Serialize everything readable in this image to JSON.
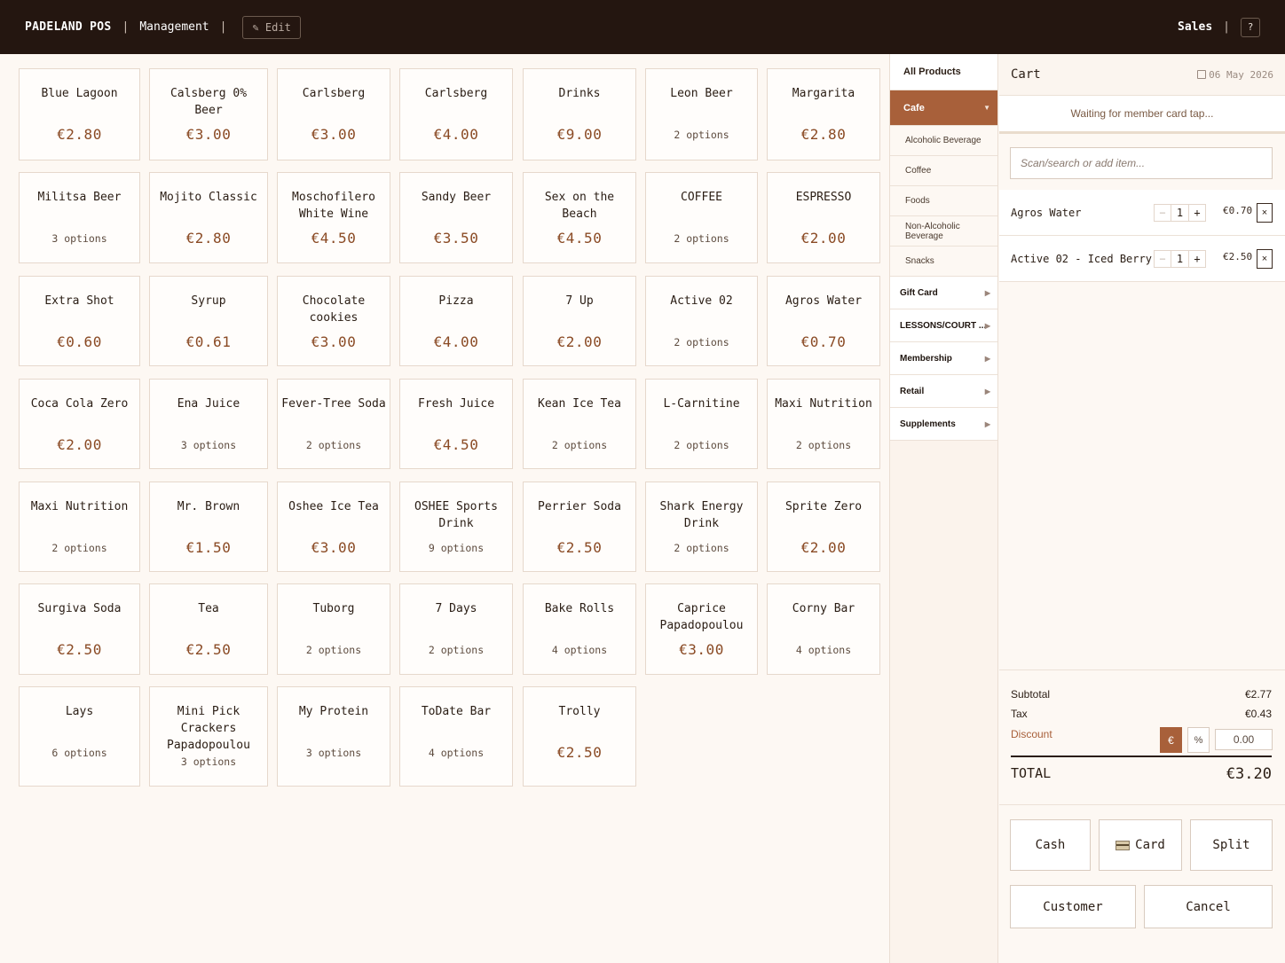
{
  "header": {
    "brand": "PADELAND POS",
    "separator": "|",
    "section": "Management",
    "edit_icon": "pencil-icon",
    "edit_label": "✎ Edit",
    "sales_label": "Sales",
    "help_label": "?"
  },
  "products": [
    {
      "name": "Blue Lagoon",
      "price": "€2.80"
    },
    {
      "name": "Calsberg 0% Beer",
      "price": "€3.00"
    },
    {
      "name": "Carlsberg",
      "price": "€3.00"
    },
    {
      "name": "Carlsberg",
      "price": "€4.00"
    },
    {
      "name": "Drinks",
      "price": "€9.00"
    },
    {
      "name": "Leon Beer",
      "options": "2 options"
    },
    {
      "name": "Margarita",
      "price": "€2.80"
    },
    {
      "name": "Militsa Beer",
      "options": "3 options"
    },
    {
      "name": "Mojito Classic",
      "price": "€2.80"
    },
    {
      "name": "Moschofilero White Wine",
      "price": "€4.50"
    },
    {
      "name": "Sandy Beer",
      "price": "€3.50"
    },
    {
      "name": "Sex on the Beach",
      "price": "€4.50"
    },
    {
      "name": "COFFEE",
      "options": "2 options"
    },
    {
      "name": "ESPRESSO",
      "price": "€2.00"
    },
    {
      "name": "Extra Shot",
      "price": "€0.60"
    },
    {
      "name": "Syrup",
      "price": "€0.61"
    },
    {
      "name": "Chocolate cookies",
      "price": "€3.00"
    },
    {
      "name": "Pizza",
      "price": "€4.00"
    },
    {
      "name": "7 Up",
      "price": "€2.00"
    },
    {
      "name": "Active 02",
      "options": "2 options"
    },
    {
      "name": "Agros Water",
      "price": "€0.70"
    },
    {
      "name": "Coca Cola Zero",
      "price": "€2.00"
    },
    {
      "name": "Ena Juice",
      "options": "3 options"
    },
    {
      "name": "Fever-Tree Soda",
      "options": "2 options"
    },
    {
      "name": "Fresh Juice",
      "price": "€4.50"
    },
    {
      "name": "Kean Ice Tea",
      "options": "2 options"
    },
    {
      "name": "L-Carnitine",
      "options": "2 options"
    },
    {
      "name": "Maxi Nutrition",
      "options": "2 options"
    },
    {
      "name": "Maxi Nutrition",
      "options": "2 options"
    },
    {
      "name": "Mr. Brown",
      "price": "€1.50"
    },
    {
      "name": "Oshee Ice Tea",
      "price": "€3.00"
    },
    {
      "name": "OSHEE Sports Drink",
      "options": "9 options"
    },
    {
      "name": "Perrier Soda",
      "price": "€2.50"
    },
    {
      "name": "Shark Energy Drink",
      "options": "2 options"
    },
    {
      "name": "Sprite Zero",
      "price": "€2.00"
    },
    {
      "name": "Surgiva Soda",
      "price": "€2.50"
    },
    {
      "name": "Tea",
      "price": "€2.50"
    },
    {
      "name": "Tuborg",
      "options": "2 options"
    },
    {
      "name": "7 Days",
      "options": "2 options"
    },
    {
      "name": "Bake Rolls",
      "options": "4 options"
    },
    {
      "name": "Caprice Papadopoulou",
      "price": "€3.00"
    },
    {
      "name": "Corny Bar",
      "options": "4 options"
    },
    {
      "name": "Lays",
      "options": "6 options"
    },
    {
      "name": "Mini Pick Crackers Papadopoulou",
      "options": "3 options"
    },
    {
      "name": "My Protein",
      "options": "3 options"
    },
    {
      "name": "ToDate Bar",
      "options": "4 options"
    },
    {
      "name": "Trolly",
      "price": "€2.50"
    }
  ],
  "categories": {
    "all": "All Products",
    "active": "Cafe",
    "subcategories": [
      "Alcoholic Beverage",
      "Coffee",
      "Foods",
      "Non-Alcoholic Beverage",
      "Snacks"
    ],
    "groups": [
      "Gift Card",
      "LESSONS/COURT ...",
      "Membership",
      "Retail",
      "Supplements"
    ],
    "expand_icon": "triangle-right-icon",
    "collapse_icon": "triangle-down-icon"
  },
  "cart": {
    "title": "Cart",
    "date": "06 May 2026",
    "calendar_icon": "calendar-icon",
    "waiting": "Waiting for member card tap...",
    "search_placeholder": "Scan/search or add item...",
    "items": [
      {
        "name": "Agros Water",
        "qty": "1",
        "price": "€0.70"
      },
      {
        "name": "Active 02 - Iced Berry",
        "qty": "1",
        "price": "€2.50"
      }
    ],
    "minus": "−",
    "plus": "+",
    "remove": "×",
    "subtotal_label": "Subtotal",
    "subtotal": "€2.77",
    "tax_label": "Tax",
    "tax": "€0.43",
    "discount_label": "Discount",
    "discount_eur": "€",
    "discount_pct": "%",
    "discount_value": "0.00",
    "total_label": "TOTAL",
    "total": "€3.20",
    "buttons": {
      "cash": "Cash",
      "card": "Card",
      "split": "Split",
      "customer": "Customer",
      "cancel": "Cancel"
    },
    "colors": {
      "accent": "#a8603a",
      "topbar": "#241610"
    }
  }
}
